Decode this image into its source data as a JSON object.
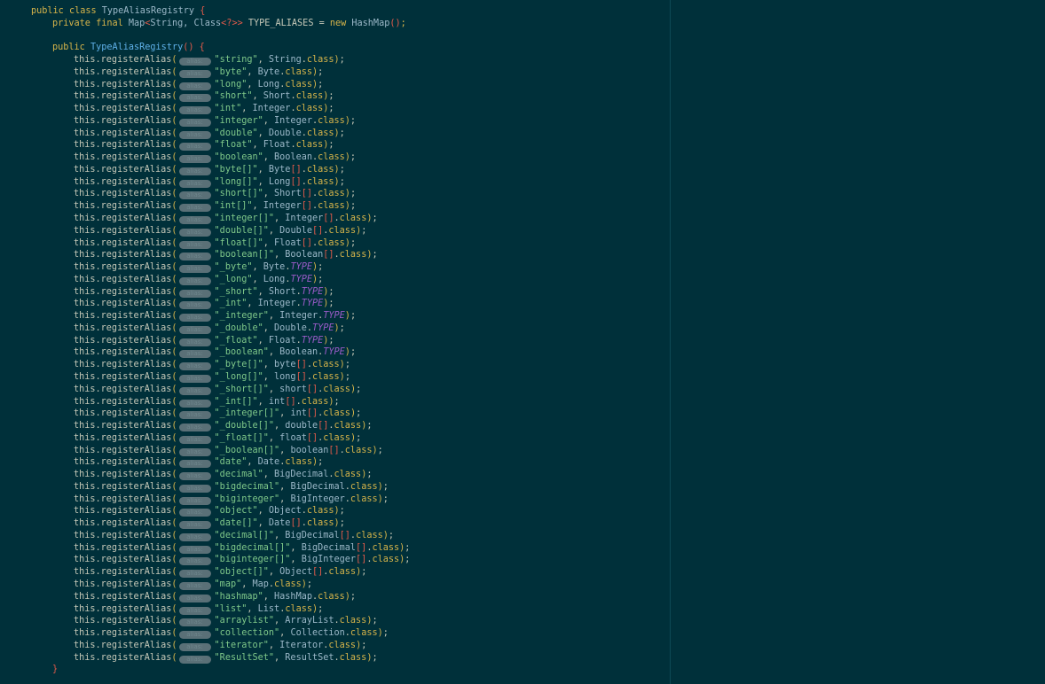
{
  "header": {
    "kw_public": "public",
    "kw_class": "class",
    "class_name": "TypeAliasRegistry",
    "open_brace": "{"
  },
  "field": {
    "modifiers": "private final",
    "map_type": "Map",
    "generic_open": "<",
    "generic_type_1": "String, ",
    "generic_type_2": "Class",
    "generic_wild": "<?>>",
    "name": " TYPE_ALIASES = ",
    "kw_new": "new",
    "hashmap": " HashMap",
    "call_parens": "()",
    "semicolon": ";"
  },
  "ctor": {
    "kw_public": "public",
    "name": "TypeAliasRegistry",
    "parens": "()",
    "open_brace": "{",
    "close_brace": "}"
  },
  "hint_label": "alias:",
  "method_prefix": "this.registerAlias",
  "registrations": [
    {
      "alias": "\"string\"",
      "type": "String",
      "arr": "",
      "suffix": "class"
    },
    {
      "alias": "\"byte\"",
      "type": "Byte",
      "arr": "",
      "suffix": "class"
    },
    {
      "alias": "\"long\"",
      "type": "Long",
      "arr": "",
      "suffix": "class"
    },
    {
      "alias": "\"short\"",
      "type": "Short",
      "arr": "",
      "suffix": "class"
    },
    {
      "alias": "\"int\"",
      "type": "Integer",
      "arr": "",
      "suffix": "class"
    },
    {
      "alias": "\"integer\"",
      "type": "Integer",
      "arr": "",
      "suffix": "class"
    },
    {
      "alias": "\"double\"",
      "type": "Double",
      "arr": "",
      "suffix": "class"
    },
    {
      "alias": "\"float\"",
      "type": "Float",
      "arr": "",
      "suffix": "class"
    },
    {
      "alias": "\"boolean\"",
      "type": "Boolean",
      "arr": "",
      "suffix": "class"
    },
    {
      "alias": "\"byte[]\"",
      "type": "Byte",
      "arr": "[]",
      "suffix": "class"
    },
    {
      "alias": "\"long[]\"",
      "type": "Long",
      "arr": "[]",
      "suffix": "class"
    },
    {
      "alias": "\"short[]\"",
      "type": "Short",
      "arr": "[]",
      "suffix": "class"
    },
    {
      "alias": "\"int[]\"",
      "type": "Integer",
      "arr": "[]",
      "suffix": "class"
    },
    {
      "alias": "\"integer[]\"",
      "type": "Integer",
      "arr": "[]",
      "suffix": "class"
    },
    {
      "alias": "\"double[]\"",
      "type": "Double",
      "arr": "[]",
      "suffix": "class"
    },
    {
      "alias": "\"float[]\"",
      "type": "Float",
      "arr": "[]",
      "suffix": "class"
    },
    {
      "alias": "\"boolean[]\"",
      "type": "Boolean",
      "arr": "[]",
      "suffix": "class"
    },
    {
      "alias": "\"_byte\"",
      "type": "Byte",
      "arr": "",
      "suffix": "TYPE"
    },
    {
      "alias": "\"_long\"",
      "type": "Long",
      "arr": "",
      "suffix": "TYPE"
    },
    {
      "alias": "\"_short\"",
      "type": "Short",
      "arr": "",
      "suffix": "TYPE"
    },
    {
      "alias": "\"_int\"",
      "type": "Integer",
      "arr": "",
      "suffix": "TYPE"
    },
    {
      "alias": "\"_integer\"",
      "type": "Integer",
      "arr": "",
      "suffix": "TYPE"
    },
    {
      "alias": "\"_double\"",
      "type": "Double",
      "arr": "",
      "suffix": "TYPE"
    },
    {
      "alias": "\"_float\"",
      "type": "Float",
      "arr": "",
      "suffix": "TYPE"
    },
    {
      "alias": "\"_boolean\"",
      "type": "Boolean",
      "arr": "",
      "suffix": "TYPE"
    },
    {
      "alias": "\"_byte[]\"",
      "type": "byte",
      "arr": "[]",
      "suffix": "class"
    },
    {
      "alias": "\"_long[]\"",
      "type": "long",
      "arr": "[]",
      "suffix": "class"
    },
    {
      "alias": "\"_short[]\"",
      "type": "short",
      "arr": "[]",
      "suffix": "class"
    },
    {
      "alias": "\"_int[]\"",
      "type": "int",
      "arr": "[]",
      "suffix": "class"
    },
    {
      "alias": "\"_integer[]\"",
      "type": "int",
      "arr": "[]",
      "suffix": "class"
    },
    {
      "alias": "\"_double[]\"",
      "type": "double",
      "arr": "[]",
      "suffix": "class"
    },
    {
      "alias": "\"_float[]\"",
      "type": "float",
      "arr": "[]",
      "suffix": "class"
    },
    {
      "alias": "\"_boolean[]\"",
      "type": "boolean",
      "arr": "[]",
      "suffix": "class"
    },
    {
      "alias": "\"date\"",
      "type": "Date",
      "arr": "",
      "suffix": "class"
    },
    {
      "alias": "\"decimal\"",
      "type": "BigDecimal",
      "arr": "",
      "suffix": "class"
    },
    {
      "alias": "\"bigdecimal\"",
      "type": "BigDecimal",
      "arr": "",
      "suffix": "class"
    },
    {
      "alias": "\"biginteger\"",
      "type": "BigInteger",
      "arr": "",
      "suffix": "class"
    },
    {
      "alias": "\"object\"",
      "type": "Object",
      "arr": "",
      "suffix": "class"
    },
    {
      "alias": "\"date[]\"",
      "type": "Date",
      "arr": "[]",
      "suffix": "class"
    },
    {
      "alias": "\"decimal[]\"",
      "type": "BigDecimal",
      "arr": "[]",
      "suffix": "class"
    },
    {
      "alias": "\"bigdecimal[]\"",
      "type": "BigDecimal",
      "arr": "[]",
      "suffix": "class"
    },
    {
      "alias": "\"biginteger[]\"",
      "type": "BigInteger",
      "arr": "[]",
      "suffix": "class"
    },
    {
      "alias": "\"object[]\"",
      "type": "Object",
      "arr": "[]",
      "suffix": "class"
    },
    {
      "alias": "\"map\"",
      "type": "Map",
      "arr": "",
      "suffix": "class"
    },
    {
      "alias": "\"hashmap\"",
      "type": "HashMap",
      "arr": "",
      "suffix": "class"
    },
    {
      "alias": "\"list\"",
      "type": "List",
      "arr": "",
      "suffix": "class"
    },
    {
      "alias": "\"arraylist\"",
      "type": "ArrayList",
      "arr": "",
      "suffix": "class"
    },
    {
      "alias": "\"collection\"",
      "type": "Collection",
      "arr": "",
      "suffix": "class"
    },
    {
      "alias": "\"iterator\"",
      "type": "Iterator",
      "arr": "",
      "suffix": "class"
    },
    {
      "alias": "\"ResultSet\"",
      "type": "ResultSet",
      "arr": "",
      "suffix": "class"
    }
  ],
  "colors": {
    "background": "#00303a",
    "keyword": "#d6b44a",
    "string": "#7fc98a",
    "bracket": "#e05a4a",
    "type_constant": "#9a5bc8",
    "method_name": "#5fb0e8"
  }
}
